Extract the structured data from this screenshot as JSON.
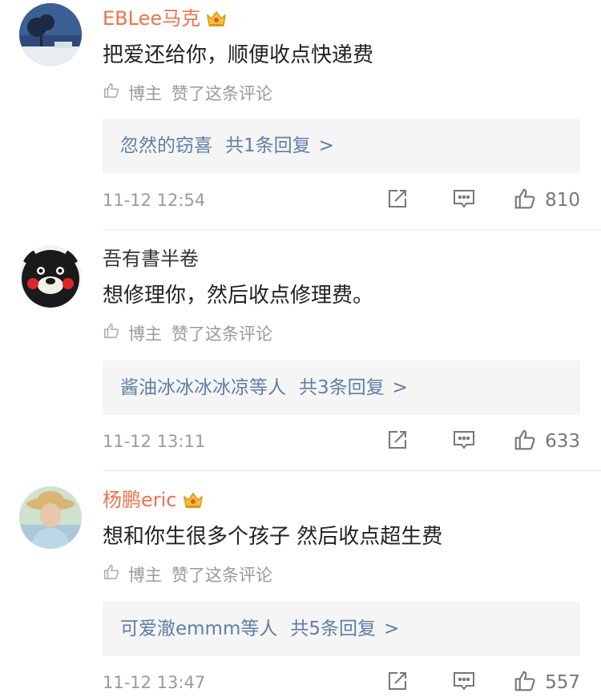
{
  "colors": {
    "vip_name": "#eb7350",
    "reply_link": "#5d7fa6",
    "muted": "#999999",
    "reply_bg": "#f5f5f5"
  },
  "comments": [
    {
      "username": "EBLee马克",
      "vip": true,
      "avatar": "tree-landscape-avatar",
      "content": "把爱还给你，顺便收点快递费",
      "author_liked": {
        "role": "博主",
        "text": "赞了这条评论"
      },
      "replies": {
        "names": "忽然的窃喜",
        "count": "共1条回复",
        "arrow": ">"
      },
      "timestamp": "11-12 12:54",
      "likes": "810"
    },
    {
      "username": "吾有書半卷",
      "vip": false,
      "avatar": "kumamon-bear-avatar",
      "content": "想修理你，然后收点修理费。",
      "author_liked": {
        "role": "博主",
        "text": "赞了这条评论"
      },
      "replies": {
        "names": "酱油冰冰冰冰凉等人",
        "count": "共3条回复",
        "arrow": ">"
      },
      "timestamp": "11-12 13:11",
      "likes": "633"
    },
    {
      "username": "杨鹏eric",
      "vip": true,
      "avatar": "person-straw-hat-avatar",
      "content": "想和你生很多个孩子  然后收点超生费",
      "author_liked": {
        "role": "博主",
        "text": "赞了这条评论"
      },
      "replies": {
        "names": "可爱澈emmm等人",
        "count": "共5条回复",
        "arrow": ">"
      },
      "timestamp": "11-12 13:47",
      "likes": "557"
    }
  ]
}
